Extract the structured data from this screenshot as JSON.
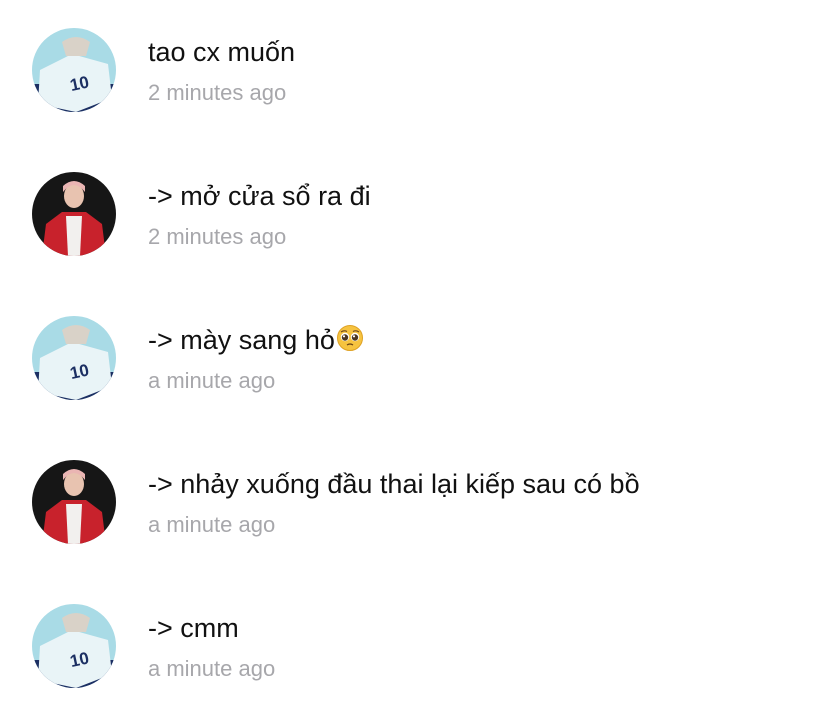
{
  "messages": [
    {
      "text": "tao cx muốn",
      "time": "2 minutes ago",
      "avatar": "avatar-blue-jersey",
      "emoji": ""
    },
    {
      "text": "-> mở cửa sổ ra đi",
      "time": "2 minutes ago",
      "avatar": "avatar-red-jacket",
      "emoji": ""
    },
    {
      "text": "-> mày sang hỏ",
      "time": "a minute ago",
      "avatar": "avatar-blue-jersey",
      "emoji": "pleading-face-emoji"
    },
    {
      "text": "-> nhảy xuống đầu thai lại kiếp sau có bồ",
      "time": "a minute ago",
      "avatar": "avatar-red-jacket",
      "emoji": ""
    },
    {
      "text": "-> cmm",
      "time": "a minute ago",
      "avatar": "avatar-blue-jersey",
      "emoji": ""
    }
  ],
  "colors": {
    "message_text": "#111111",
    "timestamp_text": "#a7a7ab",
    "background": "#ffffff"
  }
}
